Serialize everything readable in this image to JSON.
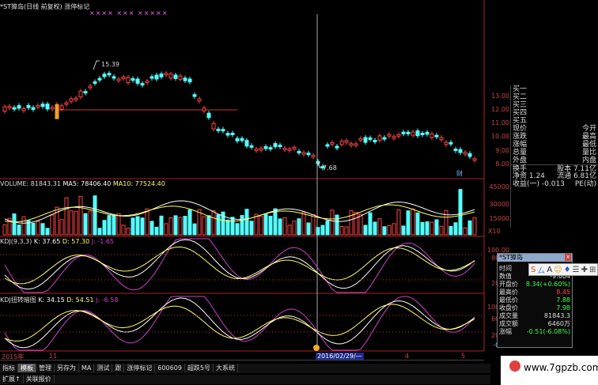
{
  "window_title": "*ST獐岛(日线 前复权) 涨停标记",
  "price_annotation_high": "15.39",
  "price_annotation_low": "7.68",
  "price_ticks": [
    "13.00",
    "12.00",
    "11.00",
    "10.00",
    "9.00",
    "8.00"
  ],
  "volume_header": {
    "label": "VOLUME: 81843.31",
    "ma5": "MA5: 78406.40",
    "ma10": "MA10: 77524.40"
  },
  "volume_ticks": [
    "45000",
    "30000",
    "15000"
  ],
  "volume_unit": "X10",
  "kdj_header": {
    "label": "KDJ(9,3,3)",
    "k": "K: 37.65",
    "d": "D: 57.30",
    "j": "J: -1.65"
  },
  "kdj2_header": {
    "label": "KDJ扭转暗图",
    "k": "K: 34.15",
    "d": "D: 54.51",
    "j": "J: -6.58"
  },
  "kdj_ticks": [
    "100.00",
    "80.00",
    "20.00"
  ],
  "kdj2_ticks": [
    "100.00",
    "60.00",
    "20.00",
    "-0.60"
  ],
  "date_axis": {
    "year": "2015年",
    "month11": "11",
    "cursor_date": "2016/02/29/—",
    "month4": "4",
    "month5": "5"
  },
  "bottom_tabs": [
    "指标",
    "模板",
    "管理",
    "另存为",
    "MA",
    "测试",
    "跟",
    "涨停标记",
    "600609",
    "超跌5号",
    "大系统"
  ],
  "bottom_tabs2": [
    "扩展↑",
    "关联报价"
  ],
  "quote_rows": [
    [
      "买一",
      ""
    ],
    [
      "买二",
      ""
    ],
    [
      "买三",
      ""
    ],
    [
      "买四",
      ""
    ],
    [
      "买五",
      ""
    ],
    [
      "现价",
      "今开"
    ],
    [
      "涨跌",
      "最高"
    ],
    [
      "涨幅",
      "最低"
    ],
    [
      "总量",
      "量比"
    ],
    [
      "外盘",
      "内盘"
    ],
    [
      "换手",
      "股本  7.11亿"
    ],
    [
      "净资  1.24",
      "流通  6.81亿"
    ],
    [
      "收益(一) -0.013",
      "PE(动)"
    ]
  ],
  "popup": {
    "title": "*ST獐岛",
    "toolbar_icons": [
      "S",
      "ㄙ",
      "A",
      "☺",
      "♦",
      "☰",
      "✚",
      "⊞"
    ],
    "rows": [
      [
        "时间",
        ""
      ],
      [
        "数值",
        "-9.604"
      ],
      [
        "开盘价",
        "8.34(+0.60%)"
      ],
      [
        "最高价",
        "8.45"
      ],
      [
        "最低价",
        "7.88"
      ],
      [
        "收盘价",
        "7.98"
      ],
      [
        "成交量",
        "81843.3"
      ],
      [
        "成交额",
        "6460万"
      ],
      [
        "涨幅",
        "-0.51(-6.08%)"
      ]
    ]
  },
  "watermark": "www.7gpzb.com",
  "candle_marks": "×××× ××× ×××××",
  "bottom_mark": "财",
  "colors": {
    "up": "#ff4444",
    "down": "#54ffff",
    "k": "#ffffff",
    "d": "#ffff66",
    "j": "#cc44cc",
    "accent": "#cc3333"
  }
}
